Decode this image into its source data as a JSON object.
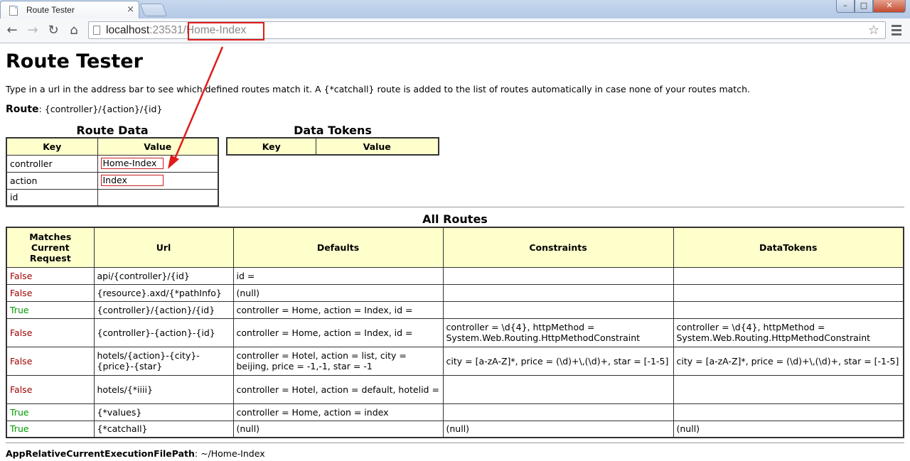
{
  "browser": {
    "tab_title": "Route Tester",
    "tab_close": "×",
    "url_host": "localhost",
    "url_port": ":23531",
    "url_path": "/Home-Index"
  },
  "page": {
    "title": "Route Tester",
    "intro": "Type in a url in the address bar to see which defined routes match it. A {*catchall} route is added to the list of routes automatically in case none of your routes match.",
    "route_label": "Route",
    "route_value": ": {controller}/{action}/{id}"
  },
  "route_data": {
    "caption": "Route Data",
    "headers": [
      "Key",
      "Value"
    ],
    "rows": [
      {
        "key": "controller",
        "value": "Home-Index"
      },
      {
        "key": "action",
        "value": "Index"
      },
      {
        "key": "id",
        "value": ""
      }
    ]
  },
  "data_tokens": {
    "caption": "Data Tokens",
    "headers": [
      "Key",
      "Value"
    ]
  },
  "all_routes": {
    "caption": "All Routes",
    "headers": [
      "Matches Current Request",
      "Url",
      "Defaults",
      "Constraints",
      "DataTokens"
    ],
    "rows": [
      {
        "match": "False",
        "url": "api/{controller}/{id}",
        "defaults": "id =",
        "constraints": "",
        "datatokens": ""
      },
      {
        "match": "False",
        "url": "{resource}.axd/{*pathInfo}",
        "defaults": "(null)",
        "constraints": "",
        "datatokens": ""
      },
      {
        "match": "True",
        "url": "{controller}/{action}/{id}",
        "defaults": "controller = Home, action = Index, id =",
        "constraints": "",
        "datatokens": ""
      },
      {
        "match": "False",
        "url": "{controller}-{action}-{id}",
        "defaults": "controller = Home, action = Index, id =",
        "constraints": "controller = \\d{4}, httpMethod = System.Web.Routing.HttpMethodConstraint",
        "datatokens": "controller = \\d{4}, httpMethod = System.Web.Routing.HttpMethodConstraint"
      },
      {
        "match": "False",
        "url": "hotels/{action}-{city}-{price}-{star}",
        "defaults": "controller = Hotel, action = list, city = beijing, price = -1,-1, star = -1",
        "constraints": "city = [a-zA-Z]*, price = (\\d)+\\,(\\d)+, star = [-1-5]",
        "datatokens": "city = [a-zA-Z]*, price = (\\d)+\\,(\\d)+, star = [-1-5]"
      },
      {
        "match": "False",
        "url": "hotels/{*iiii}",
        "defaults": "controller = Hotel, action = default, hotelid =",
        "constraints": "",
        "datatokens": ""
      },
      {
        "match": "True",
        "url": "{*values}",
        "defaults": "controller = Home, action = index",
        "constraints": "",
        "datatokens": ""
      },
      {
        "match": "True",
        "url": "{*catchall}",
        "defaults": "(null)",
        "constraints": "(null)",
        "datatokens": "(null)"
      }
    ]
  },
  "footer": {
    "label": "AppRelativeCurrentExecutionFilePath",
    "value": ": ~/Home-Index"
  },
  "colors": {
    "annotation": "#e01b1b",
    "header_bg": "#ffffcc",
    "false_text": "#a00000",
    "true_text": "#009900"
  }
}
